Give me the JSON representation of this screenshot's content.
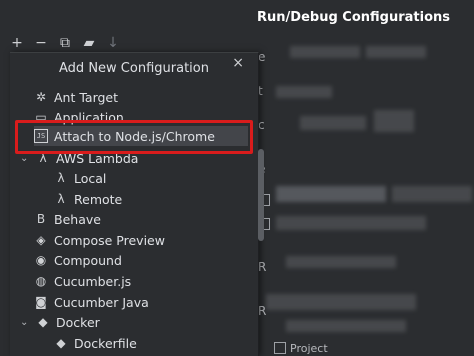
{
  "window": {
    "title": "Run/Debug Configurations"
  },
  "toolbar": {
    "add_icon": "+",
    "remove_icon": "−",
    "copy_icon": "⧉",
    "folder_icon": "▰",
    "sort_icon": "↓"
  },
  "popup": {
    "title": "Add New Configuration",
    "close_icon": "×",
    "items": [
      {
        "label": "Ant Target",
        "icon": "ant-icon",
        "glyph": "✲"
      },
      {
        "label": "Application",
        "icon": "application-icon",
        "glyph": "▭"
      },
      {
        "label": "Attach to Node.js/Chrome",
        "icon": "js-icon",
        "glyph": "JS"
      },
      {
        "label": "AWS Lambda",
        "icon": "lambda-icon",
        "glyph": "λ"
      },
      {
        "label": "Local",
        "icon": "lambda-icon",
        "glyph": "λ"
      },
      {
        "label": "Remote",
        "icon": "lambda-icon",
        "glyph": "λ"
      },
      {
        "label": "Behave",
        "icon": "behave-icon",
        "glyph": "B"
      },
      {
        "label": "Compose Preview",
        "icon": "compose-icon",
        "glyph": "◈"
      },
      {
        "label": "Compound",
        "icon": "compound-icon",
        "glyph": "◉"
      },
      {
        "label": "Cucumber.js",
        "icon": "cucumber-icon",
        "glyph": "◍"
      },
      {
        "label": "Cucumber Java",
        "icon": "cucumber-java-icon",
        "glyph": "◙"
      },
      {
        "label": "Docker",
        "icon": "docker-icon",
        "glyph": "◆"
      },
      {
        "label": "Dockerfile",
        "icon": "docker-icon",
        "glyph": "◆"
      }
    ]
  },
  "right_panel": {
    "glyphs": [
      "e",
      "t",
      "c",
      "e",
      "R",
      "R"
    ],
    "project_label": "Project"
  },
  "colors": {
    "highlight": "#d91c1c",
    "selection": "#43454a",
    "background": "#2b2d30"
  }
}
